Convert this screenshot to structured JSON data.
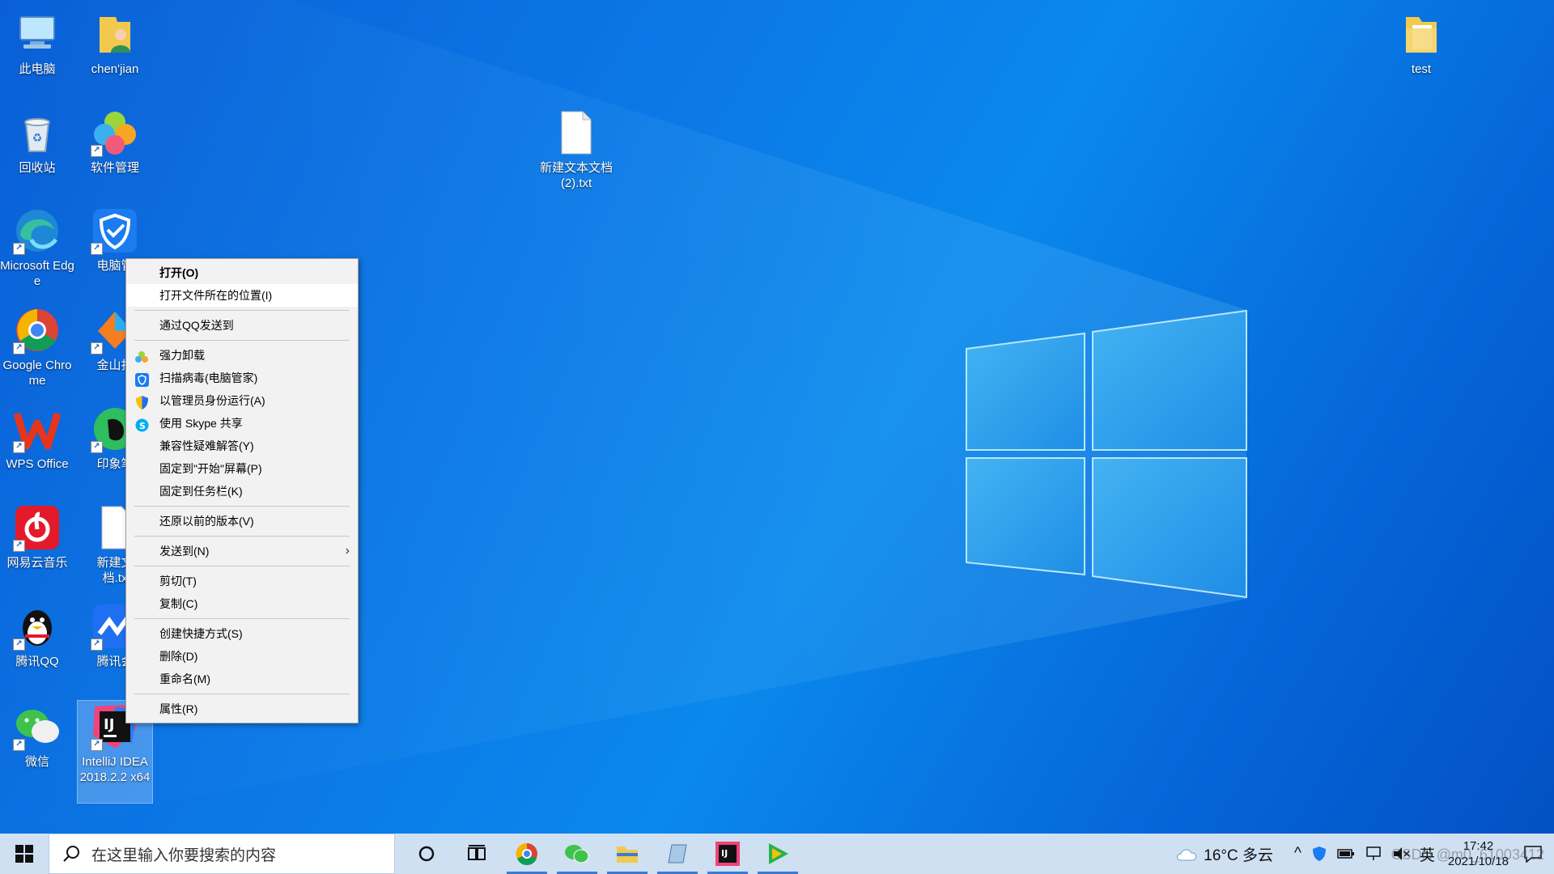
{
  "desktop_icons": [
    {
      "label": "此电脑",
      "icon": "computer-icon"
    },
    {
      "label": "chen'jian",
      "icon": "user-folder-icon"
    },
    {
      "label": "回收站",
      "icon": "recycle-bin-icon"
    },
    {
      "label": "软件管理",
      "icon": "software-manager-icon"
    },
    {
      "label": "Microsoft Edge",
      "icon": "edge-icon"
    },
    {
      "label": "电脑管",
      "icon": "tencent-pc-manager-icon"
    },
    {
      "label": "Google Chrome",
      "icon": "chrome-icon"
    },
    {
      "label": "金山打",
      "icon": "kingsoft-typing-icon"
    },
    {
      "label": "WPS Office",
      "icon": "wps-icon"
    },
    {
      "label": "印象笔",
      "icon": "evernote-icon"
    },
    {
      "label": "网易云音乐",
      "icon": "netease-music-icon"
    },
    {
      "label": "新建文\n档.tx",
      "icon": "text-file-icon"
    },
    {
      "label": "腾讯QQ",
      "icon": "qq-icon"
    },
    {
      "label": "腾讯会",
      "icon": "tencent-meeting-icon"
    },
    {
      "label": "微信",
      "icon": "wechat-icon"
    },
    {
      "label": "IntelliJ IDEA 2018.2.2 x64",
      "icon": "intellij-icon"
    },
    {
      "label": "新建文本文档 (2).txt",
      "icon": "text-file-icon"
    },
    {
      "label": "test",
      "icon": "folder-icon"
    }
  ],
  "context_menu": {
    "items": [
      {
        "label": "打开(O)",
        "bold": true
      },
      {
        "label": "打开文件所在的位置(I)"
      },
      {
        "sep": true
      },
      {
        "label": "通过QQ发送到"
      },
      {
        "sep": true
      },
      {
        "label": "强力卸载",
        "icon": "uninstall-icon"
      },
      {
        "label": "扫描病毒(电脑管家)",
        "icon": "pc-manager-shield-icon"
      },
      {
        "label": "以管理员身份运行(A)",
        "icon": "admin-shield-icon"
      },
      {
        "label": "使用 Skype 共享",
        "icon": "skype-icon"
      },
      {
        "label": "兼容性疑难解答(Y)"
      },
      {
        "label": "固定到\"开始\"屏幕(P)"
      },
      {
        "label": "固定到任务栏(K)"
      },
      {
        "sep": true
      },
      {
        "label": "还原以前的版本(V)"
      },
      {
        "sep": true
      },
      {
        "label": "发送到(N)",
        "submenu": true
      },
      {
        "sep": true
      },
      {
        "label": "剪切(T)"
      },
      {
        "label": "复制(C)"
      },
      {
        "sep": true
      },
      {
        "label": "创建快捷方式(S)"
      },
      {
        "label": "删除(D)"
      },
      {
        "label": "重命名(M)"
      },
      {
        "sep": true
      },
      {
        "label": "属性(R)"
      }
    ]
  },
  "taskbar": {
    "search_placeholder": "在这里输入你要搜索的内容",
    "apps": [
      "cortana-icon",
      "task-view-icon",
      "chrome-icon",
      "wechat-icon",
      "file-explorer-icon",
      "notepad-icon",
      "intellij-icon",
      "media-player-icon"
    ],
    "weather": "16°C 多云",
    "ime": "英",
    "time": "17:42",
    "date": "2021/10/18"
  },
  "watermark": "CSDN @m0_61003412",
  "colors": {
    "accent": "#3a7bd5",
    "desktop_blue": "#0b78e6",
    "taskbar": "#cfe0f3"
  }
}
